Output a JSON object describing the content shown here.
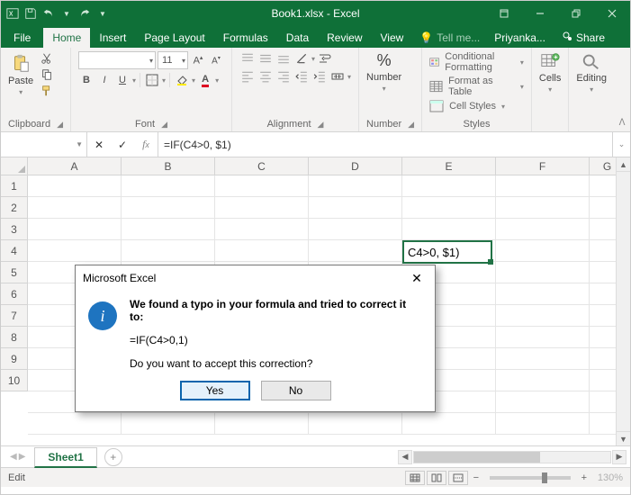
{
  "title": "Book1.xlsx - Excel",
  "quick_access": [
    "save",
    "undo",
    "redo",
    "customize"
  ],
  "window_controls": {
    "ribbon_opts": "ribbon-opts",
    "minimize": "minimize",
    "restore": "restore",
    "close": "close"
  },
  "tabs": {
    "file": "File",
    "list": [
      "Home",
      "Insert",
      "Page Layout",
      "Formulas",
      "Data",
      "Review",
      "View"
    ],
    "active": "Home",
    "tell_me": "Tell me...",
    "user": "Priyanka...",
    "share": "Share"
  },
  "ribbon": {
    "clipboard": {
      "label": "Clipboard",
      "paste": "Paste"
    },
    "font": {
      "label": "Font",
      "family_placeholder": "",
      "size": "11",
      "buttons": {
        "bold": "B",
        "italic": "I",
        "underline": "U"
      }
    },
    "alignment": {
      "label": "Alignment"
    },
    "number": {
      "label": "Number",
      "btn": "Number"
    },
    "styles": {
      "label": "Styles",
      "cond": "Conditional Formatting",
      "table": "Format as Table",
      "cell": "Cell Styles"
    },
    "cells": {
      "label": "Cells",
      "btn": "Cells"
    },
    "editing": {
      "label": "Editing",
      "btn": "Editing"
    }
  },
  "namebox": "",
  "formula": "=IF(C4>0, $1)",
  "columns": [
    "A",
    "B",
    "C",
    "D",
    "E",
    "F",
    "G"
  ],
  "rows": [
    "1",
    "2",
    "3",
    "4",
    "5",
    "6",
    "7",
    "8",
    "9",
    "10"
  ],
  "active_cell_display": "C4>0, $1)",
  "sheet_tabs": {
    "active": "Sheet1"
  },
  "statusbar": {
    "mode": "Edit",
    "zoom": "130%"
  },
  "dialog": {
    "title": "Microsoft Excel",
    "line1": "We found a typo in your formula and tried to correct it to:",
    "suggestion": "=IF(C4>0,1)",
    "line2": "Do you want to accept this correction?",
    "yes": "Yes",
    "no": "No"
  }
}
